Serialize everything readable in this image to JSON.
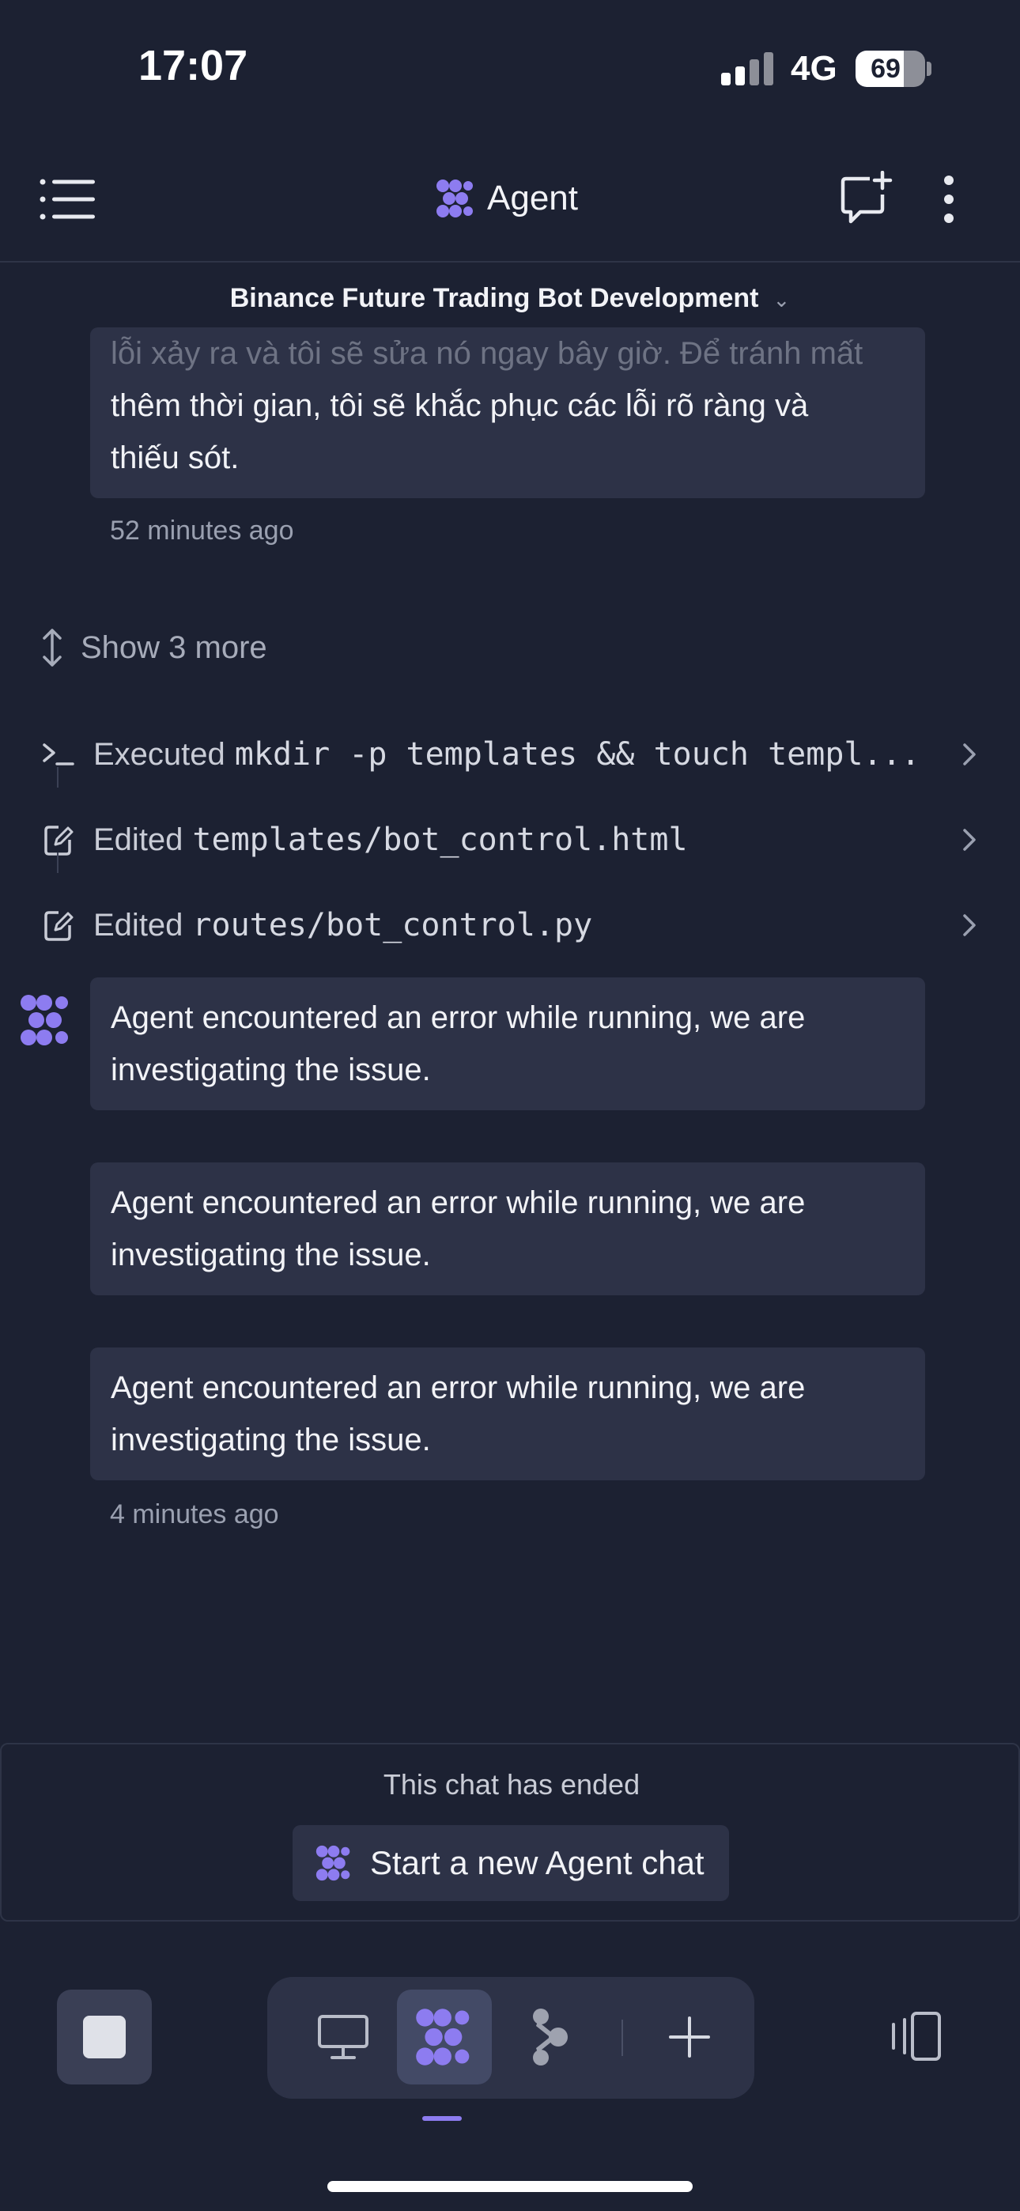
{
  "status_bar": {
    "time": "17:07",
    "network": "4G",
    "battery": "69",
    "battery_level": 0.69
  },
  "header": {
    "title": "Agent"
  },
  "thread": {
    "title": "Binance Future Trading Bot Development"
  },
  "messages": {
    "first": {
      "line1": "lỗi xảy ra và tôi sẽ sửa nó ngay bây giờ. Để tránh mất",
      "line2": "thêm thời gian, tôi sẽ khắc phục các lỗi rõ ràng và",
      "line3": "thiếu sót.",
      "time": "52 minutes ago"
    },
    "error_1": "Agent encountered an error while running, we are investigating the issue.",
    "error_2": "Agent encountered an error while running, we are investigating the issue.",
    "error_3": "Agent encountered an error while running, we are investigating the issue.",
    "last_time": "4 minutes ago"
  },
  "actions": {
    "show_more": "Show 3 more",
    "items": [
      {
        "verb": "Executed",
        "target": "mkdir -p templates && touch templ..."
      },
      {
        "verb": "Edited",
        "target": "templates/bot_control.html"
      },
      {
        "verb": "Edited",
        "target": "routes/bot_control.py"
      }
    ]
  },
  "footer": {
    "ended_text": "This chat has ended",
    "start_button": "Start a new Agent chat"
  },
  "colors": {
    "accent": "#8d7cf0",
    "background": "#1c2132",
    "bubble": "#2d3247"
  },
  "icons": [
    "menu-icon",
    "agent-logo-icon",
    "new-chat-icon",
    "more-vert-icon",
    "terminal-icon",
    "edit-file-icon",
    "chevron-right-icon",
    "desktop-icon",
    "branch-icon",
    "plus-icon",
    "panels-icon",
    "stop-icon"
  ]
}
